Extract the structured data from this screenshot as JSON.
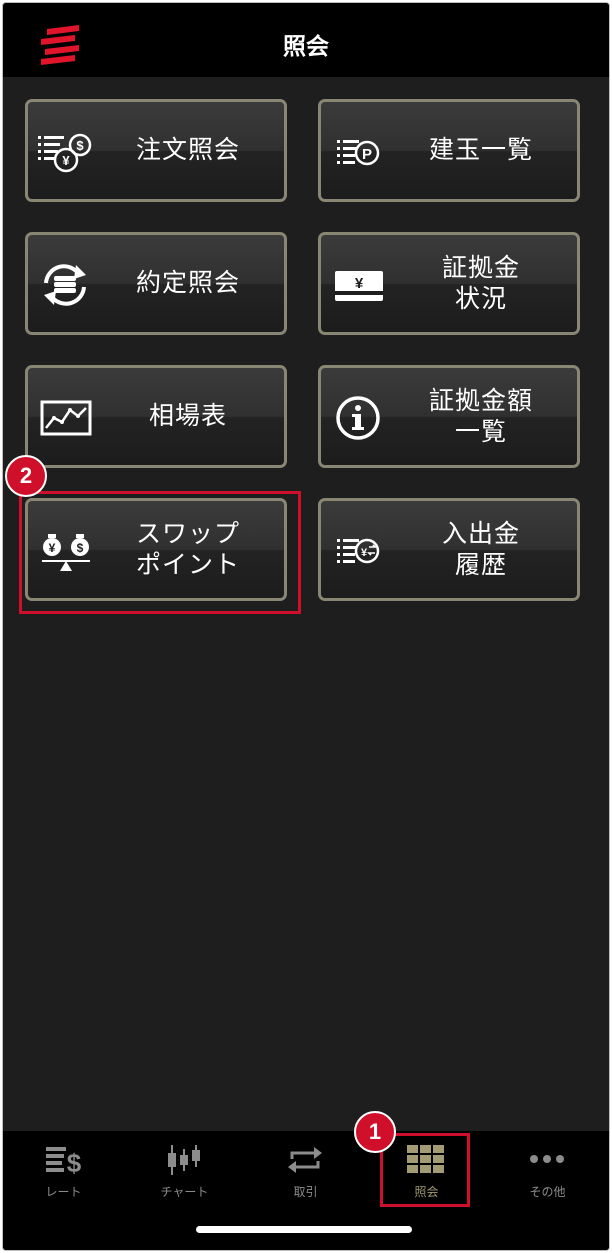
{
  "header": {
    "title": "照会"
  },
  "tiles": [
    {
      "name": "tile-order-inquiry",
      "icon": "order-list-yen-dollar-icon",
      "lines": [
        "注文照会"
      ]
    },
    {
      "name": "tile-positions-list",
      "icon": "position-list-p-icon",
      "lines": [
        "建玉一覧"
      ]
    },
    {
      "name": "tile-execution-inquiry",
      "icon": "coin-cycle-icon",
      "lines": [
        "約定照会"
      ]
    },
    {
      "name": "tile-margin-status",
      "icon": "yen-card-icon",
      "lines": [
        "証拠金",
        "状況"
      ]
    },
    {
      "name": "tile-market-table",
      "icon": "line-chart-icon",
      "lines": [
        "相場表"
      ]
    },
    {
      "name": "tile-margin-amount-list",
      "icon": "info-icon",
      "lines": [
        "証拠金額",
        "一覧"
      ]
    },
    {
      "name": "tile-swap-points",
      "icon": "currency-balance-icon",
      "lines": [
        "スワップ",
        "ポイント"
      ]
    },
    {
      "name": "tile-deposit-withdrawal-history",
      "icon": "transfer-list-icon",
      "lines": [
        "入出金",
        "履歴"
      ]
    }
  ],
  "callouts": [
    "1",
    "2"
  ],
  "tabbar": {
    "items": [
      {
        "label": "レート",
        "icon": "rate-list-icon",
        "active": false
      },
      {
        "label": "チャート",
        "icon": "candlestick-icon",
        "active": false
      },
      {
        "label": "取引",
        "icon": "exchange-arrows-icon",
        "active": false
      },
      {
        "label": "照会",
        "icon": "grid-icon",
        "active": true
      },
      {
        "label": "その他",
        "icon": "more-dots-icon",
        "active": false
      }
    ]
  },
  "colors": {
    "accent": "#d0102b",
    "tile_border": "#8a8674",
    "active_tab": "#a39b73",
    "inactive_tab": "#8c8c8c",
    "background": "#1e1e1e"
  }
}
